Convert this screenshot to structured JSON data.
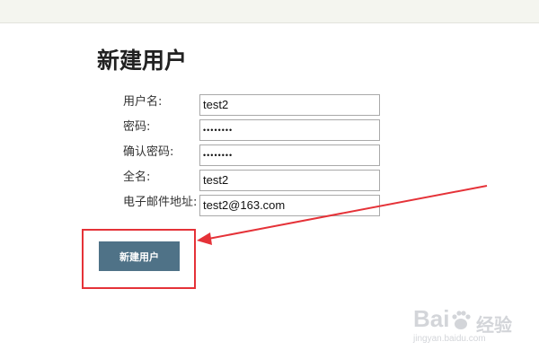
{
  "page": {
    "title": "新建用户"
  },
  "form": {
    "fields": [
      {
        "label": "用户名:",
        "value": "test2",
        "type": "text"
      },
      {
        "label": "密码:",
        "value": "••••••••",
        "type": "password"
      },
      {
        "label": "确认密码:",
        "value": "••••••••",
        "type": "password"
      },
      {
        "label": "全名:",
        "value": "test2",
        "type": "text"
      },
      {
        "label": "电子邮件地址:",
        "value": "test2@163.com",
        "type": "text"
      }
    ],
    "submit_label": "新建用户"
  },
  "annotation": {
    "color": "#e53238"
  },
  "watermark": {
    "main": "Bai",
    "cn": "经验",
    "sub": "jingyan.baidu.com"
  },
  "colors": {
    "button": "#4f7287",
    "top_bar": "#f4f5ef"
  }
}
